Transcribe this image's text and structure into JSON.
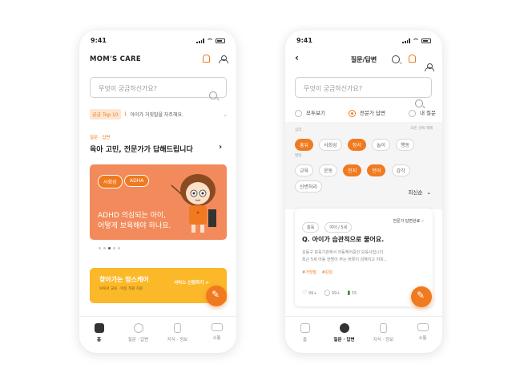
{
  "status_time": "9:41",
  "phone1": {
    "logo": "MOM'S CARE",
    "search_placeholder": "무엇이 궁금하신가요?",
    "top_badge": "궁금 Top 10",
    "top_rank": "1",
    "top_text": "아이가 거짓말을 자주해요.",
    "section_label": "질문 · 답변",
    "section_title": "육아 고민, 전문가가 답해드립니다",
    "banner_tags": [
      "사회성",
      "ADHA"
    ],
    "banner_line1": "ADHD 의심되는 아이,",
    "banner_line2": "어떻게 보육해야 하나요.",
    "promo_title": "찾아가는 맘스케어",
    "promo_sub": "보육서 교육 · 아동 직원 지원",
    "promo_button": "서비스 신청하기 >",
    "tabs": [
      "홈",
      "질문 · 답변",
      "지식 · 정보",
      "소통"
    ]
  },
  "phone2": {
    "title": "질문/답변",
    "search_placeholder": "무엇이 궁금하신가요?",
    "radio_options": [
      "모두보기",
      "전문가 답변",
      "내 질문"
    ],
    "group1_label": "심리",
    "group1_hint": "모든 선택 해제",
    "group1_chips": [
      "흥유",
      "사회성",
      "정서",
      "놀이",
      "행동"
    ],
    "group2_label": "발달",
    "group2_chips": [
      "교육",
      "운동",
      "인지",
      "언어",
      "감각",
      "신변처리"
    ],
    "sort_label": "최신순",
    "card": {
      "tags": [
        "흥육",
        "여아 / 5세"
      ],
      "answered": "전문가 답변완료",
      "question": "Q. 아이가 습관적으로 물어요.",
      "body_line1": "성동구 보육기관에서 아동케어중인 보육사입니다.",
      "body_line2": "최근 5세 아동 한명이 무는 버릇이 심해지고 저희...",
      "hashtags": [
        "#거짓말",
        "#감성"
      ],
      "likes": "99+",
      "comments": "99+",
      "saves": "55"
    },
    "tabs": [
      "홈",
      "질문 · 답변",
      "지식 · 정보",
      "소통"
    ]
  }
}
